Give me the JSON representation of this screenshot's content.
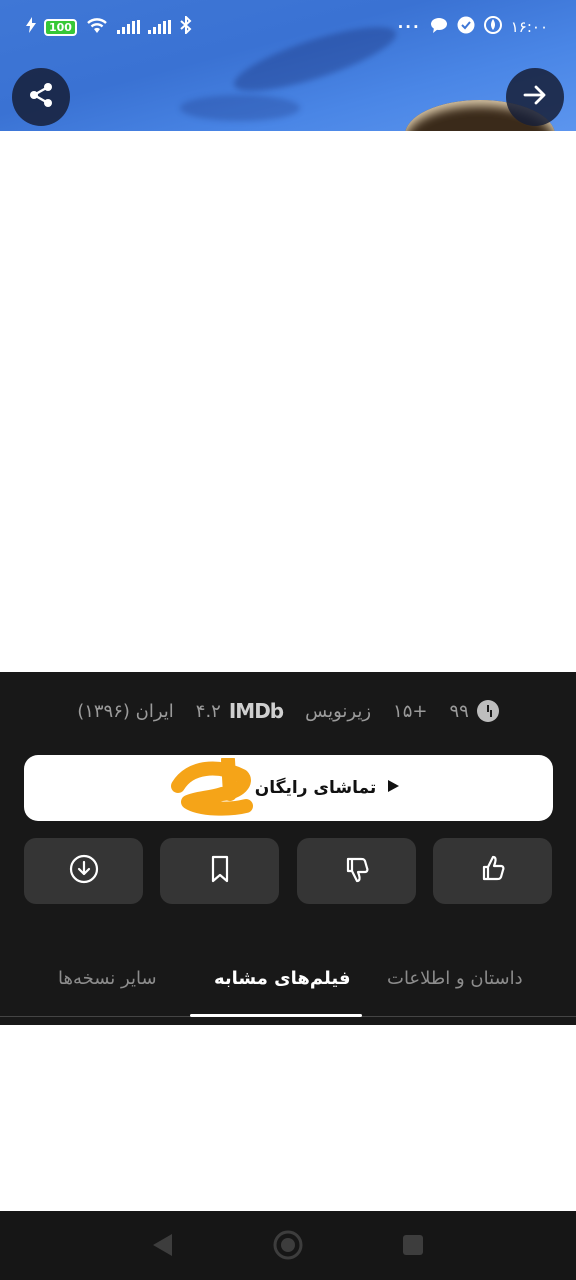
{
  "status_bar": {
    "battery": "100",
    "time": "۱۶:۰۰",
    "dots": "···"
  },
  "meta": {
    "duration": "۹۹",
    "age_rating": "+۱۵",
    "subtitle": "زیرنویس",
    "imdb_label": "IMDb",
    "imdb_score": "۴.۲",
    "country_year": "ایران (۱۳۹۶)"
  },
  "watch_button": {
    "label": "تماشای رایگان"
  },
  "tabs": [
    {
      "label": "داستان و اطلاعات",
      "active": false
    },
    {
      "label": "فیلم‌های مشابه",
      "active": true
    },
    {
      "label": "سایر نسخه‌ها",
      "active": false
    }
  ],
  "colors": {
    "panel_bg": "#181818",
    "action_bg": "#353535",
    "hero_blue": "#3f77d6",
    "scribble": "#f5a418"
  }
}
